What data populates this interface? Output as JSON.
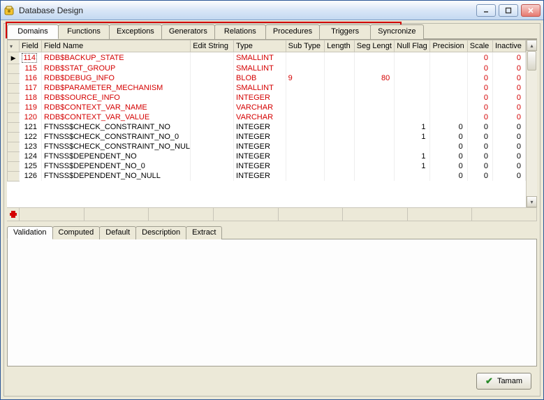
{
  "window": {
    "title": "Database Design"
  },
  "mainTabs": [
    {
      "label": "Domains",
      "active": true
    },
    {
      "label": "Functions"
    },
    {
      "label": "Exceptions"
    },
    {
      "label": "Generators"
    },
    {
      "label": "Relations"
    },
    {
      "label": "Procedures"
    },
    {
      "label": "Triggers"
    },
    {
      "label": "Syncronize"
    }
  ],
  "columns": {
    "ind": "",
    "field": "Field",
    "name": "Field Name",
    "edit": "Edit String",
    "type": "Type",
    "sub": "Sub Type",
    "len": "Length",
    "seg": "Seg Lengt",
    "null": "Null Flag",
    "prec": "Precision",
    "scale": "Scale",
    "inact": "Inactive"
  },
  "rows": [
    {
      "red": true,
      "cur": true,
      "field": "114",
      "name": "RDB$BACKUP_STATE",
      "type": "SMALLINT",
      "sub": "",
      "len": "",
      "seg": "",
      "null": "",
      "prec": "",
      "scale": "0",
      "inact": "0"
    },
    {
      "red": true,
      "field": "115",
      "name": "RDB$STAT_GROUP",
      "type": "SMALLINT",
      "sub": "",
      "len": "",
      "seg": "",
      "null": "",
      "prec": "",
      "scale": "0",
      "inact": "0"
    },
    {
      "red": true,
      "field": "116",
      "name": "RDB$DEBUG_INFO",
      "type": "BLOB",
      "sub": "9",
      "len": "",
      "seg": "80",
      "null": "",
      "prec": "",
      "scale": "0",
      "inact": "0"
    },
    {
      "red": true,
      "field": "117",
      "name": "RDB$PARAMETER_MECHANISM",
      "type": "SMALLINT",
      "sub": "",
      "len": "",
      "seg": "",
      "null": "",
      "prec": "",
      "scale": "0",
      "inact": "0"
    },
    {
      "red": true,
      "field": "118",
      "name": "RDB$SOURCE_INFO",
      "type": "INTEGER",
      "sub": "",
      "len": "",
      "seg": "",
      "null": "",
      "prec": "",
      "scale": "0",
      "inact": "0"
    },
    {
      "red": true,
      "field": "119",
      "name": "RDB$CONTEXT_VAR_NAME",
      "type": "VARCHAR",
      "sub": "",
      "len": "",
      "seg": "",
      "null": "",
      "prec": "",
      "scale": "0",
      "inact": "0"
    },
    {
      "red": true,
      "field": "120",
      "name": "RDB$CONTEXT_VAR_VALUE",
      "type": "VARCHAR",
      "sub": "",
      "len": "",
      "seg": "",
      "null": "",
      "prec": "",
      "scale": "0",
      "inact": "0"
    },
    {
      "field": "121",
      "name": "FTNSS$CHECK_CONSTRAINT_NO",
      "type": "INTEGER",
      "sub": "",
      "len": "",
      "seg": "",
      "null": "1",
      "prec": "0",
      "scale": "0",
      "inact": "0"
    },
    {
      "field": "122",
      "name": "FTNSS$CHECK_CONSTRAINT_NO_0",
      "type": "INTEGER",
      "sub": "",
      "len": "",
      "seg": "",
      "null": "1",
      "prec": "0",
      "scale": "0",
      "inact": "0"
    },
    {
      "field": "123",
      "name": "FTNSS$CHECK_CONSTRAINT_NO_NULL",
      "type": "INTEGER",
      "sub": "",
      "len": "",
      "seg": "",
      "null": "",
      "prec": "0",
      "scale": "0",
      "inact": "0"
    },
    {
      "field": "124",
      "name": "FTNSS$DEPENDENT_NO",
      "type": "INTEGER",
      "sub": "",
      "len": "",
      "seg": "",
      "null": "1",
      "prec": "0",
      "scale": "0",
      "inact": "0"
    },
    {
      "field": "125",
      "name": "FTNSS$DEPENDENT_NO_0",
      "type": "INTEGER",
      "sub": "",
      "len": "",
      "seg": "",
      "null": "1",
      "prec": "0",
      "scale": "0",
      "inact": "0"
    },
    {
      "field": "126",
      "name": "FTNSS$DEPENDENT_NO_NULL",
      "type": "INTEGER",
      "sub": "",
      "len": "",
      "seg": "",
      "null": "",
      "prec": "0",
      "scale": "0",
      "inact": "0"
    }
  ],
  "subTabs": [
    {
      "label": "Validation",
      "active": true
    },
    {
      "label": "Computed"
    },
    {
      "label": "Default"
    },
    {
      "label": "Description"
    },
    {
      "label": "Extract"
    }
  ],
  "buttons": {
    "ok": "Tamam"
  },
  "highlightCount": 7
}
